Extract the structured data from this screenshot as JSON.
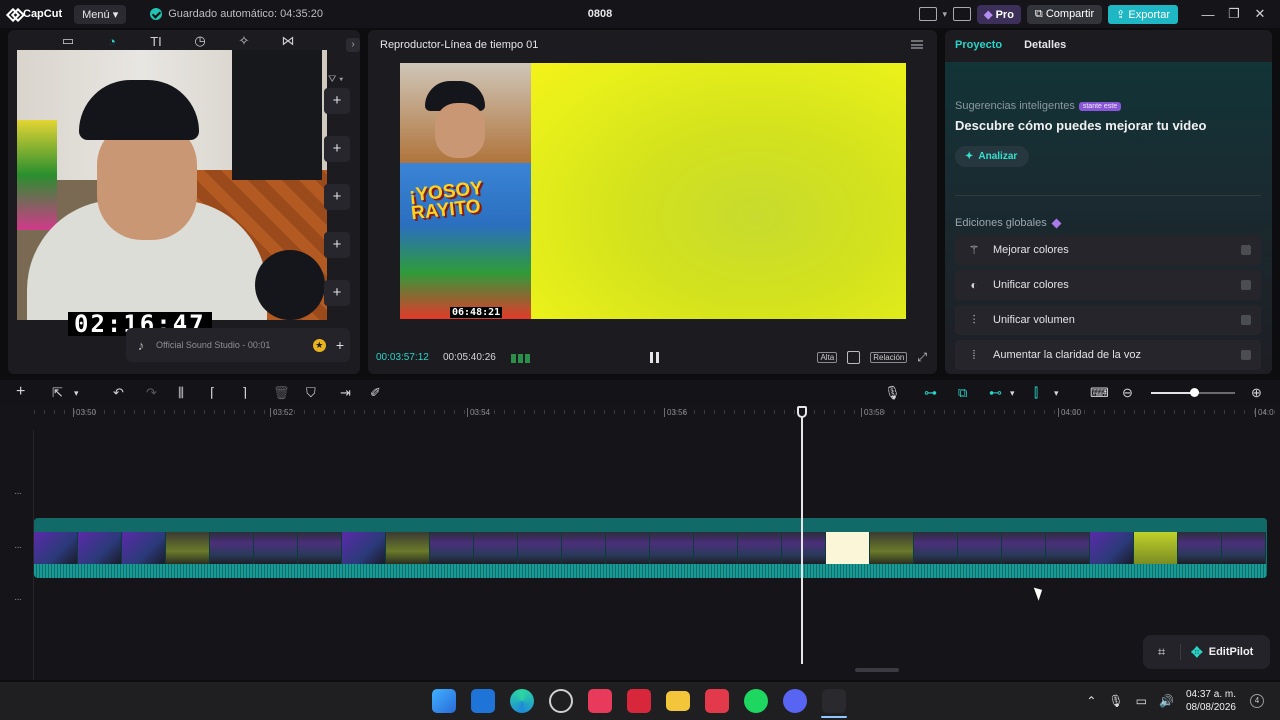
{
  "titlebar": {
    "app_name": "CapCut",
    "menu_label": "Menú",
    "autosave_label": "Guardado automático: 04:35:20",
    "project_name": "0808",
    "pro_label": "Pro",
    "share_label": "Compartir",
    "export_label": "Exportar"
  },
  "media": {
    "webcam_timer": "02:16:47",
    "sound_title": "Official Sound Studio - 00:01"
  },
  "player": {
    "title": "Reproductor-Línea de tiempo 01",
    "current_time": "00:03:57:12",
    "duration": "00:05:40:26",
    "quality_label": "Alta",
    "ratio_label": "Relación",
    "preview_poster_title": "¡YOSOY RAYITO",
    "preview_timer": "06:48:21"
  },
  "right_panel": {
    "tabs": [
      {
        "label": "Proyecto",
        "active": true
      },
      {
        "label": "Detalles",
        "active": false
      }
    ],
    "suggestions_heading": "Sugerencias inteligentes",
    "suggestions_badge": "stante este",
    "suggestions_title": "Descubre cómo puedes mejorar tu video",
    "analyze_label": "Analizar",
    "global_heading": "Ediciones globales",
    "global_edits": [
      {
        "label": "Mejorar colores",
        "icon": "magic-wand-icon"
      },
      {
        "label": "Unificar colores",
        "icon": "palette-icon"
      },
      {
        "label": "Unificar volumen",
        "icon": "sliders-icon"
      },
      {
        "label": "Aumentar la claridad de la voz",
        "icon": "voice-wave-icon"
      }
    ]
  },
  "timeline": {
    "ruler_labels": [
      "03:50",
      "03:52",
      "03:54",
      "03:56",
      "03:58",
      "04:00",
      "04:0"
    ],
    "editpilot_label": "EditPilot"
  },
  "taskbar": {
    "time": "04:37 a. m.",
    "date": "08/08/2026",
    "notifications": "4"
  },
  "colors": {
    "accent": "#2ad4c8",
    "export": "#1fb7c4",
    "clip_track": "#0f6d6b"
  }
}
